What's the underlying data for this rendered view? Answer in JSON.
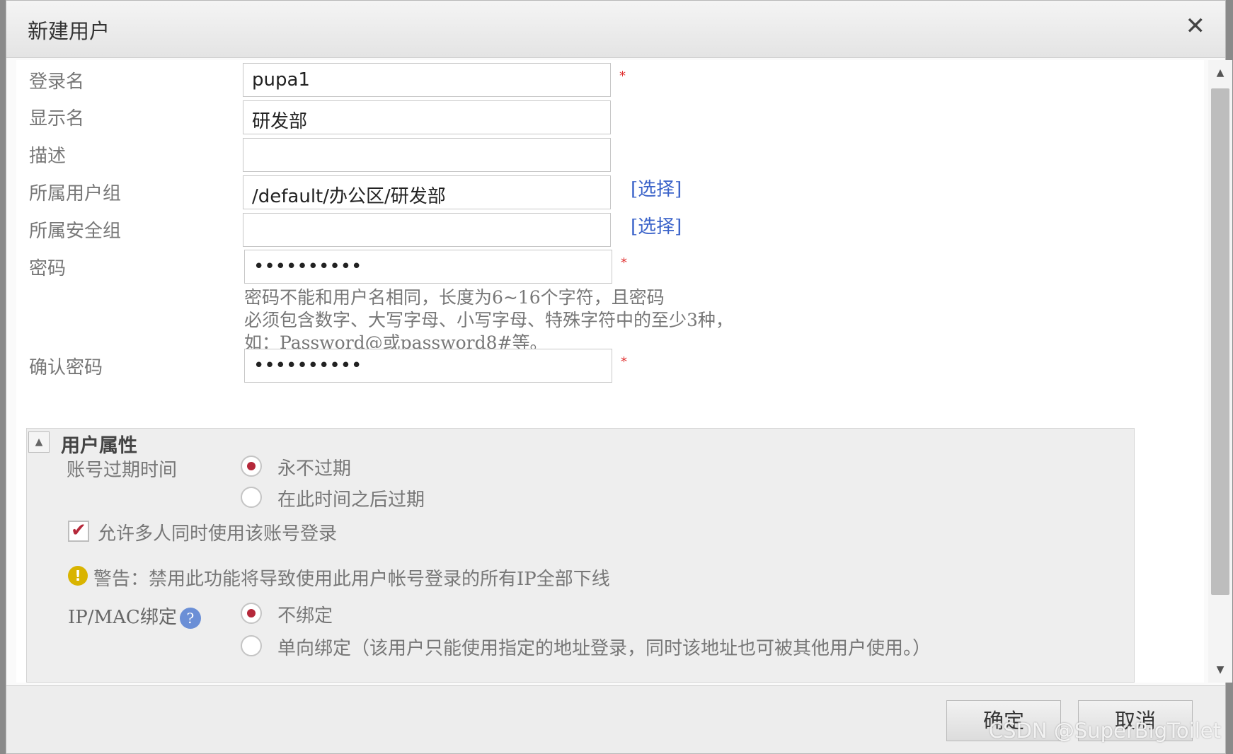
{
  "dialog": {
    "title": "新建用户",
    "close_glyph": "✕"
  },
  "form": {
    "login_name": {
      "label": "登录名",
      "value": "pupa1",
      "required_mark": "*"
    },
    "display_name": {
      "label": "显示名",
      "value": "研发部"
    },
    "description": {
      "label": "描述",
      "value": ""
    },
    "user_group": {
      "label": "所属用户组",
      "value": "/default/办公区/研发部",
      "pick_label": "[选择]"
    },
    "security_group": {
      "label": "所属安全组",
      "value": "",
      "pick_label": "[选择]"
    },
    "password": {
      "label": "密码",
      "value": "••••••••••",
      "required_mark": "*",
      "hint_lines": [
        "密码不能和用户名相同，长度为6~16个字符，且密码",
        "必须包含数字、大写字母、小写字母、特殊字符中的至少3种，",
        "如：Password@或password8#等。"
      ]
    },
    "confirm_password": {
      "label": "确认密码",
      "value": "••••••••••",
      "required_mark": "*"
    }
  },
  "user_props": {
    "collapse_glyph": "▲",
    "title": "用户属性",
    "expiry": {
      "label": "账号过期时间",
      "options": [
        {
          "label": "永不过期",
          "checked": true
        },
        {
          "label": "在此时间之后过期",
          "checked": false
        }
      ]
    },
    "multi_login": {
      "label": "允许多人同时使用该账号登录",
      "checked": true,
      "check_glyph": "✔"
    },
    "warning": {
      "icon_glyph": "!",
      "text": "警告：禁用此功能将导致使用此用户帐号登录的所有IP全部下线"
    },
    "ipmac": {
      "label": "IP/MAC绑定",
      "help_glyph": "?",
      "options": [
        {
          "label": "不绑定",
          "checked": true
        },
        {
          "label": "单向绑定（该用户只能使用指定的地址登录，同时该地址也可被其他用户使用。）",
          "checked": false
        }
      ]
    }
  },
  "scrollbar": {
    "up_glyph": "▲",
    "down_glyph": "▼"
  },
  "footer": {
    "ok_label": "确定",
    "cancel_label": "取消",
    "watermark": "CSDN @SuperBigToilet"
  },
  "colors": {
    "accent_radio": "#b5283a",
    "link": "#3b63c9",
    "required": "#e03030"
  }
}
